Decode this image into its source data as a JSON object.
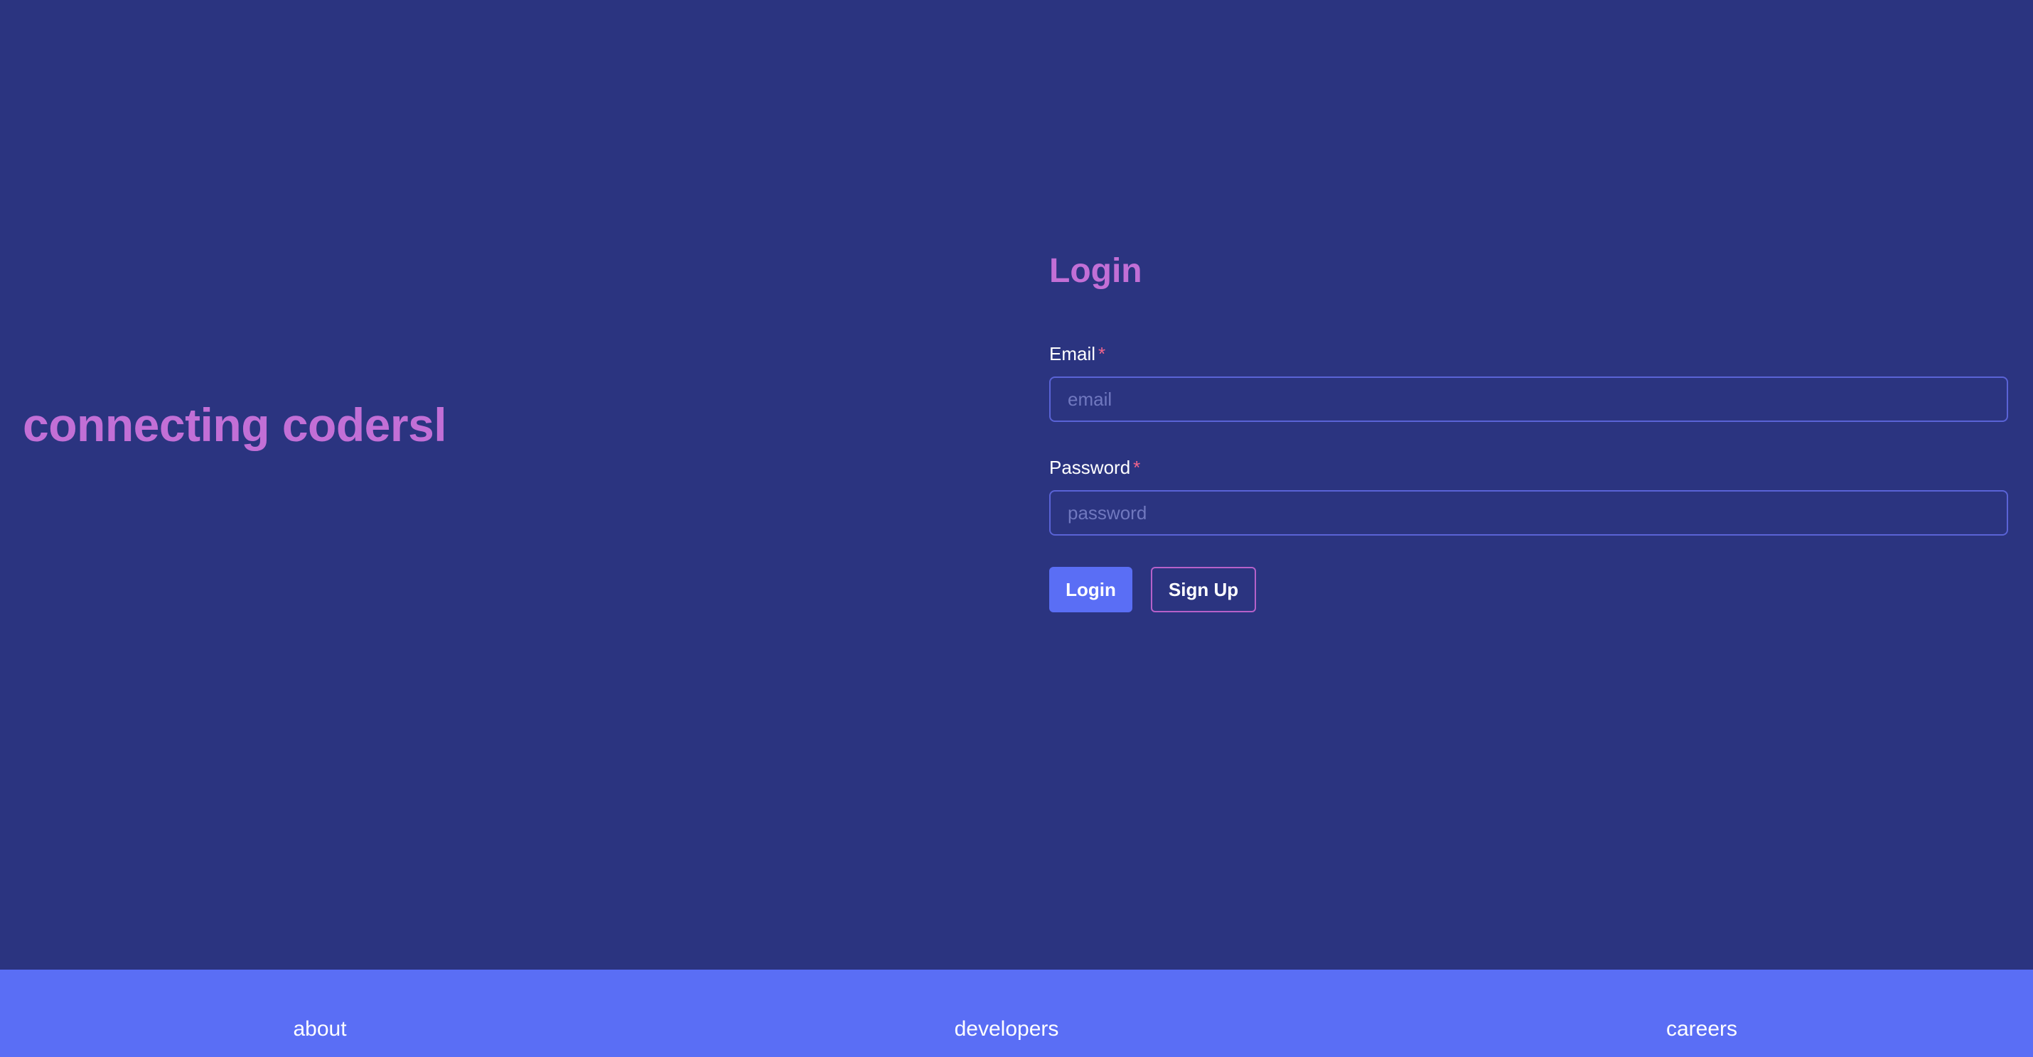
{
  "hero": {
    "tagline": "connecting codersl"
  },
  "login": {
    "title": "Login",
    "email": {
      "label": "Email",
      "required_mark": "*",
      "placeholder": "email",
      "value": ""
    },
    "password": {
      "label": "Password",
      "required_mark": "*",
      "placeholder": "password",
      "value": ""
    },
    "login_button": "Login",
    "signup_button": "Sign Up"
  },
  "footer": {
    "links": [
      "about",
      "developers",
      "careers"
    ]
  },
  "colors": {
    "background": "#2b3480",
    "accent": "#c26fd6",
    "primary": "#5a6ef5",
    "required": "#f2648c"
  }
}
